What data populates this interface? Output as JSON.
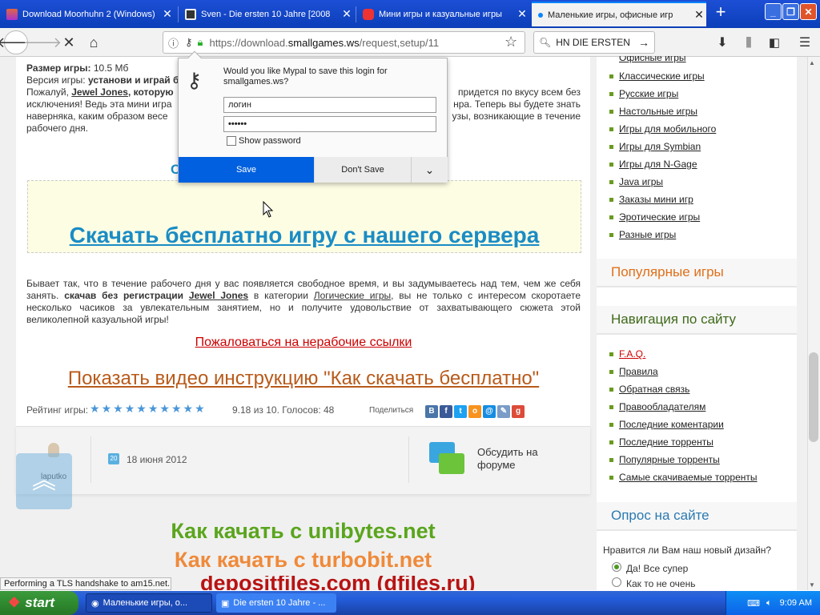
{
  "tabs": [
    {
      "label": "Download Moorhuhn 2 (Windows)",
      "icon": "moorhuhn-tab-icon",
      "active": false
    },
    {
      "label": "Sven - Die ersten 10 Jahre [2008",
      "icon": "book-tab-icon",
      "active": false
    },
    {
      "label": "Мини игры и казуальные игры",
      "icon": "games-tab-icon",
      "active": false
    },
    {
      "label": "Маленькие игры, офисные игр",
      "icon": "page-tab-icon",
      "active": true
    }
  ],
  "nav": {
    "url_prefix": "https://download.",
    "url_domain": "smallgames.ws",
    "url_path": "/request,setup/11",
    "search_value": "HN DIE ERSTEN"
  },
  "game": {
    "size_label": "Размер игры:",
    "size_value": "10.5 Мб",
    "version_label": "Версия игры:",
    "version_value": "установи и играй бо",
    "desc_1": "Пожалуй,",
    "desc_link": "Jewel Jones",
    "desc_2": ", которую",
    "desc_right_1": "придется по вкусу всем без",
    "desc_left_2": "исключения! Ведь эта мини игра",
    "desc_right_2": "нра. Теперь вы будете знать",
    "desc_left_3": "наверняка, каким образом весе",
    "desc_right_3": "узы, возникающие в течение",
    "desc_left_4": "рабочего дня.",
    "hidden_letter": "С",
    "download_link": "Скачать бесплатно игру с нашего сервера",
    "para2_a": "Бывает так, что в течение рабочего дня у вас появляется свободное время, и вы задумываетесь над тем, чем же себя занять.",
    "para2_bold": "скачав без регистрации",
    "para2_link1": "Jewel Jones",
    "para2_b": "в категории",
    "para2_link2": "Логические игры",
    "para2_c": ", вы не только с интересом скоротаете несколько часиков за увлекательным занятием, но и получите удовольствие от захватывающего сюжета этой великолепной казуальной игры!",
    "complain_link": "Пожаловаться на нерабочие ссылки",
    "video_link": "Показать видео инструкцию \"Как скачать бесплатно\"",
    "rating_label": "Рейтинг игры:",
    "rating_stars": 10,
    "rating_text": "9.18 из 10. Голосов: 48",
    "share_label": "Поделиться",
    "author": "laputko",
    "date_day": "20",
    "date": "18 июня 2012",
    "forum_label": "Обсудить на форуме"
  },
  "promo": {
    "line1": "Как качать с unibytes.net",
    "line2": "Как качать с turbobit.net",
    "line3": "depositfiles.com (dfiles.ru)",
    "color1": "#5aa51d",
    "color2": "#ef8a3a",
    "color3": "#b81313"
  },
  "sidebar": {
    "categories": [
      "Офисные игры",
      "Классические игры",
      "Русские игры",
      "Настольные игры",
      "Игры для мобильного",
      "Игры для Symbian",
      "Игры для N-Gage",
      "Java игры",
      "Заказы мини игр",
      "Эротические игры",
      "Разные игры"
    ],
    "popular_heading": "Популярные игры",
    "nav_heading": "Навигация по сайту",
    "nav_links": [
      "F.A.Q.",
      "Правила",
      "Обратная связь",
      "Правообладателям",
      "Последние коментарии",
      "Последние торренты",
      "Популярные торренты",
      "Самые скачиваемые торренты"
    ],
    "poll_heading": "Опрос на сайте",
    "poll_question": "Нравится ли Вам наш новый дизайн?",
    "poll_options": [
      "Да! Все супер",
      "Как то не очень"
    ]
  },
  "dialog": {
    "message": "Would you like Mypal to save this login for smallgames.ws?",
    "username": "логин",
    "password": "••••••",
    "show_password": "Show password",
    "save": "Save",
    "dont_save": "Don't Save"
  },
  "status": "Performing a TLS handshake to am15.net...",
  "taskbar": {
    "start": "start",
    "tasks": [
      "Маленькие игры, о...",
      "Die ersten 10 Jahre - ..."
    ],
    "clock": "9:09 AM"
  },
  "colors": {
    "accent": "#0060df",
    "link_blue": "#1a8cc4",
    "orange_heading": "#e0701a",
    "green_heading": "#3f6a1a"
  }
}
